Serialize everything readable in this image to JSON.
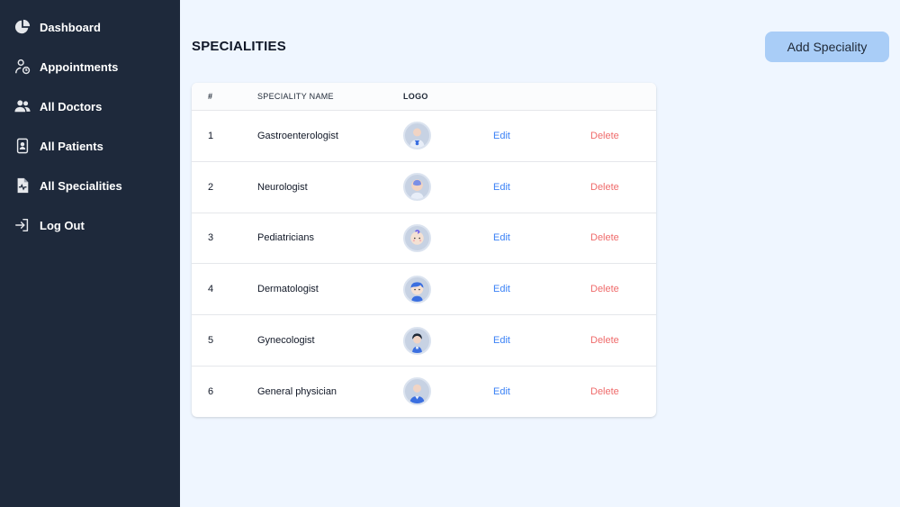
{
  "sidebar": {
    "items": [
      {
        "label": "Dashboard",
        "icon": "pie-chart-icon"
      },
      {
        "label": "Appointments",
        "icon": "user-clock-icon"
      },
      {
        "label": "All Doctors",
        "icon": "users-icon"
      },
      {
        "label": "All Patients",
        "icon": "id-badge-icon"
      },
      {
        "label": "All Specialities",
        "icon": "file-medical-icon"
      },
      {
        "label": "Log Out",
        "icon": "logout-icon"
      }
    ]
  },
  "main": {
    "title": "SPECIALITIES",
    "add_button": "Add Speciality",
    "table": {
      "headers": [
        "#",
        "SPECIALITY NAME",
        "LOGO"
      ],
      "edit_label": "Edit",
      "delete_label": "Delete",
      "rows": [
        {
          "num": "1",
          "name": "Gastroenterologist",
          "logo": "gastroenterologist-avatar"
        },
        {
          "num": "2",
          "name": "Neurologist",
          "logo": "neurologist-avatar"
        },
        {
          "num": "3",
          "name": "Pediatricians",
          "logo": "pediatrician-avatar"
        },
        {
          "num": "4",
          "name": "Dermatologist",
          "logo": "dermatologist-avatar"
        },
        {
          "num": "5",
          "name": "Gynecologist",
          "logo": "gynecologist-avatar"
        },
        {
          "num": "6",
          "name": "General physician",
          "logo": "general-physician-avatar"
        }
      ]
    }
  },
  "colors": {
    "sidebar_bg": "#1e293b",
    "page_bg": "#eff6ff",
    "button_bg": "#a9cdf7",
    "edit": "#3b82f6",
    "delete": "#ef6b6b"
  }
}
